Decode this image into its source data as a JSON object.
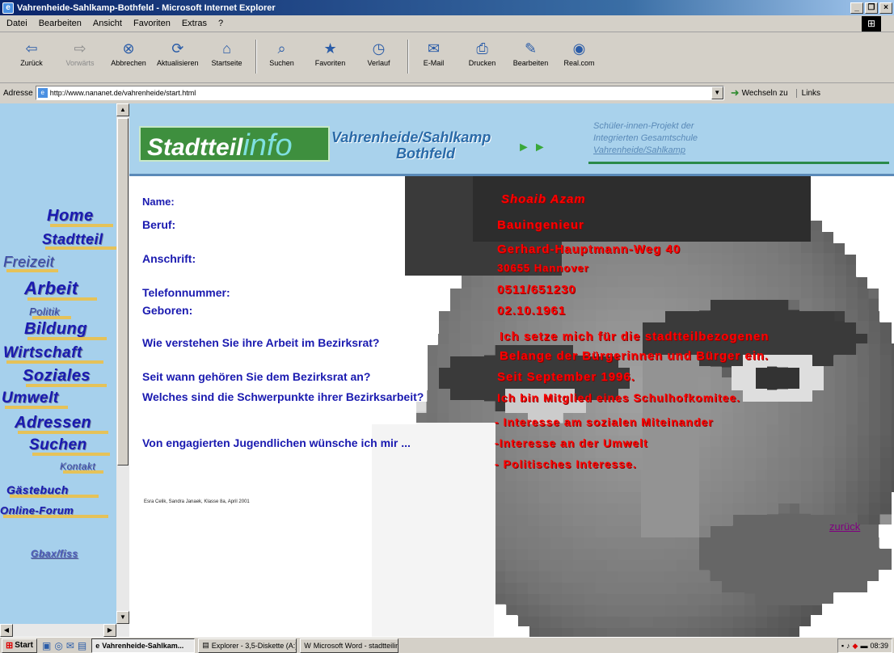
{
  "window": {
    "title": "Vahrenheide-Sahlkamp-Bothfeld - Microsoft Internet Explorer"
  },
  "menu": [
    "Datei",
    "Bearbeiten",
    "Ansicht",
    "Favoriten",
    "Extras",
    "?"
  ],
  "toolbar": [
    {
      "label": "Zurück",
      "icon": "back-arrow-icon"
    },
    {
      "label": "Vorwärts",
      "icon": "forward-arrow-icon"
    },
    {
      "label": "Abbrechen",
      "icon": "stop-icon"
    },
    {
      "label": "Aktualisieren",
      "icon": "refresh-icon"
    },
    {
      "label": "Startseite",
      "icon": "home-icon"
    },
    {
      "label": "Suchen",
      "icon": "search-icon"
    },
    {
      "label": "Favoriten",
      "icon": "favorites-icon"
    },
    {
      "label": "Verlauf",
      "icon": "history-icon"
    },
    {
      "label": "E-Mail",
      "icon": "mail-icon"
    },
    {
      "label": "Drucken",
      "icon": "print-icon"
    },
    {
      "label": "Bearbeiten",
      "icon": "edit-icon"
    },
    {
      "label": "Real.com",
      "icon": "real-icon"
    }
  ],
  "address": {
    "label": "Adresse",
    "url": "http://www.nananet.de/vahrenheide/start.html",
    "go": "Wechseln zu",
    "links": "Links"
  },
  "nav": [
    "Home",
    "Stadtteil",
    "Freizeit",
    "Arbeit",
    "Politik",
    "Bildung",
    "Wirtschaft",
    "Soziales",
    "Umwelt",
    "Adressen",
    "Suchen",
    "Kontakt",
    "Gästebuch",
    "Online-Forum",
    "Gbax/fiss"
  ],
  "banner": {
    "logo_prefix": "Stadtteil",
    "logo_suffix": "info",
    "title_line1": "Vahrenheide/Sahlkamp",
    "title_line2": "Bothfeld",
    "project": [
      "Schüler-innen-Projekt der",
      "Integrierten Gesamtschule",
      "Vahrenheide/Sahlkamp"
    ]
  },
  "profile": {
    "labels": [
      "Name:",
      "Beruf:",
      "Anschrift:",
      "Telefonnummer:",
      "Geboren:",
      "Wie verstehen Sie ihre Arbeit im Bezirksrat?",
      "Seit wann gehören Sie dem Bezirksrat an?",
      "Welches sind die Schwerpunkte ihrer Bezirksarbeit?",
      "Von engagierten Jugendlichen wünsche ich mir ..."
    ],
    "values": [
      "Shoaib Azam",
      "Bauingenieur",
      "Gerhard-Hauptmann-Weg 40",
      "30655 Hannover",
      "0511/651230",
      "02.10.1961",
      "Ich setze mich für die stadtteilbezogenen",
      "Belange der Bürgerinnen und Bürger ein.",
      "Seit September 1996.",
      "Ich bin Mitglied eines Schulhofkomitee.",
      "- Interesse am sozialen Miteinander",
      "-Interesse an der Umwelt",
      "- Politisches Interesse."
    ]
  },
  "credit": "Esra Celik, Sandra Janaek, Klasse 8a, April 2001",
  "back_link": "zurück",
  "taskbar": {
    "start": "Start",
    "tasks": [
      "Vahrenheide-Sahlkam...",
      "Explorer - 3,5-Diskette (A:)",
      "Microsoft Word - stadtteilin..."
    ],
    "time": "08:39"
  }
}
